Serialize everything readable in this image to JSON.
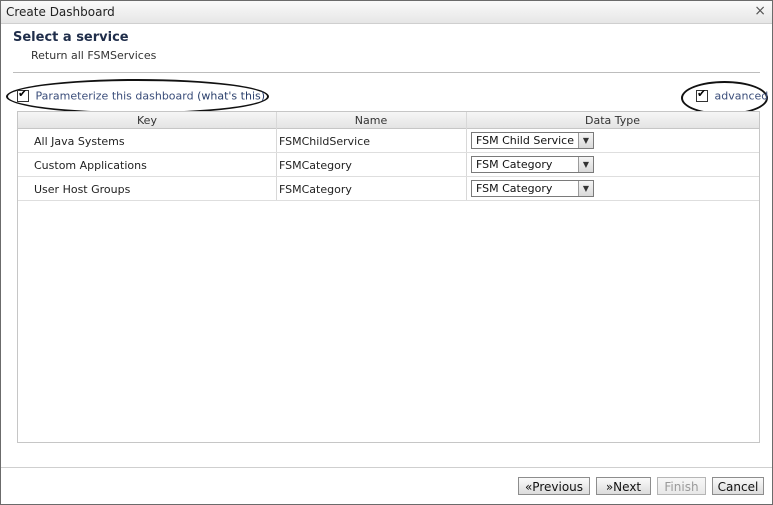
{
  "window": {
    "title": "Create Dashboard",
    "close_glyph": "×"
  },
  "header": {
    "title": "Select a service",
    "subtitle": "Return all FSMServices"
  },
  "options": {
    "parameterize": {
      "label": "Parameterize this dashboard",
      "help_link": "(what's this)",
      "checked": true
    },
    "advanced": {
      "label": "advanced",
      "checked": true
    }
  },
  "grid": {
    "columns": [
      "Key",
      "Name",
      "Data Type"
    ],
    "rows": [
      {
        "key": "All Java Systems",
        "name": "FSMChildService",
        "data_type": "FSM Child Service"
      },
      {
        "key": "Custom Applications",
        "name": "FSMCategory",
        "data_type": "FSM Category"
      },
      {
        "key": "User Host Groups",
        "name": "FSMCategory",
        "data_type": "FSM Category"
      }
    ]
  },
  "footer": {
    "previous": "«Previous",
    "next": "»Next",
    "finish": "Finish",
    "cancel": "Cancel"
  },
  "icons": {
    "checkbox_tick": "✔",
    "dropdown_arrow": "▼"
  }
}
